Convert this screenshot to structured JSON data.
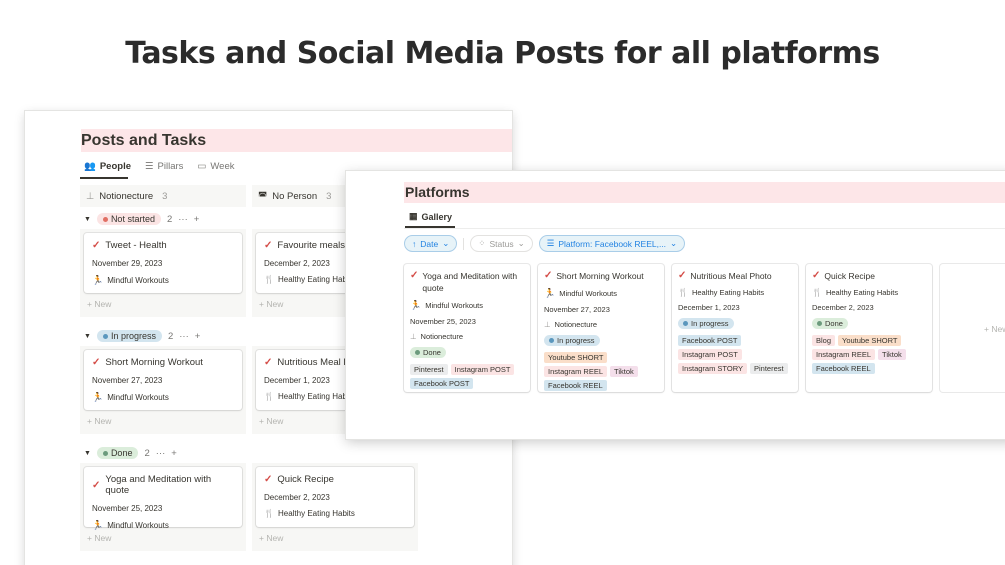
{
  "headline": "Tasks and Social Media Posts for all platforms",
  "board": {
    "title": "Posts and Tasks",
    "tabs": [
      "People",
      "Pillars",
      "Week"
    ],
    "columns": [
      {
        "name": "Notionecture",
        "count": "3"
      },
      {
        "name": "No Person",
        "count": "3"
      }
    ],
    "new_label": "+ New",
    "groups": [
      {
        "status": "Not started",
        "count": "2",
        "color": "#e16f64",
        "cards": [
          {
            "title": "Tweet - Health",
            "date": "November 29, 2023",
            "pillar": "Mindful Workouts"
          },
          {
            "title": "Favourite meals",
            "date": "December 2, 2023",
            "pillar": "Healthy Eating Habits"
          }
        ]
      },
      {
        "status": "In progress",
        "count": "2",
        "color": "#5b97bd",
        "cards": [
          {
            "title": "Short Morning Workout",
            "date": "November 27, 2023",
            "pillar": "Mindful Workouts"
          },
          {
            "title": "Nutritious Meal Photo",
            "date": "December 1, 2023",
            "pillar": "Healthy Eating Habits"
          }
        ]
      },
      {
        "status": "Done",
        "count": "2",
        "color": "#6c9b7d",
        "cards": [
          {
            "title": "Yoga and Meditation with quote",
            "date": "November 25, 2023",
            "pillar": "Mindful Workouts"
          },
          {
            "title": "Quick Recipe",
            "date": "December 2, 2023",
            "pillar": "Healthy Eating Habits"
          }
        ]
      }
    ]
  },
  "gallery": {
    "title": "Platforms",
    "tab": "Gallery",
    "filters": {
      "date": "Date",
      "status": "Status",
      "platform": "Platform: Facebook REEL,..."
    },
    "new_label": "+ New",
    "cards": [
      {
        "title": "Yoga and Meditation with quote",
        "pillar": "Mindful Workouts",
        "date": "November 25, 2023",
        "person": "Notionecture",
        "status": "Done",
        "platforms": [
          "Pinterest",
          "Instagram POST",
          "Facebook POST"
        ]
      },
      {
        "title": "Short Morning Workout",
        "pillar": "Mindful Workouts",
        "date": "November 27, 2023",
        "person": "Notionecture",
        "status": "In progress",
        "platforms": [
          "Youtube SHORT",
          "Instagram REEL",
          "Tiktok",
          "Facebook REEL"
        ]
      },
      {
        "title": "Nutritious Meal Photo",
        "pillar": "Healthy Eating Habits",
        "date": "December 1, 2023",
        "status": "In progress",
        "platforms": [
          "Facebook POST",
          "Instagram POST",
          "Instagram STORY",
          "Pinterest"
        ]
      },
      {
        "title": "Quick Recipe",
        "pillar": "Healthy Eating Habits",
        "date": "December 2, 2023",
        "status": "Done",
        "platforms": [
          "Blog",
          "Youtube SHORT",
          "Instagram REEL",
          "Tiktok",
          "Facebook REEL"
        ]
      }
    ]
  }
}
